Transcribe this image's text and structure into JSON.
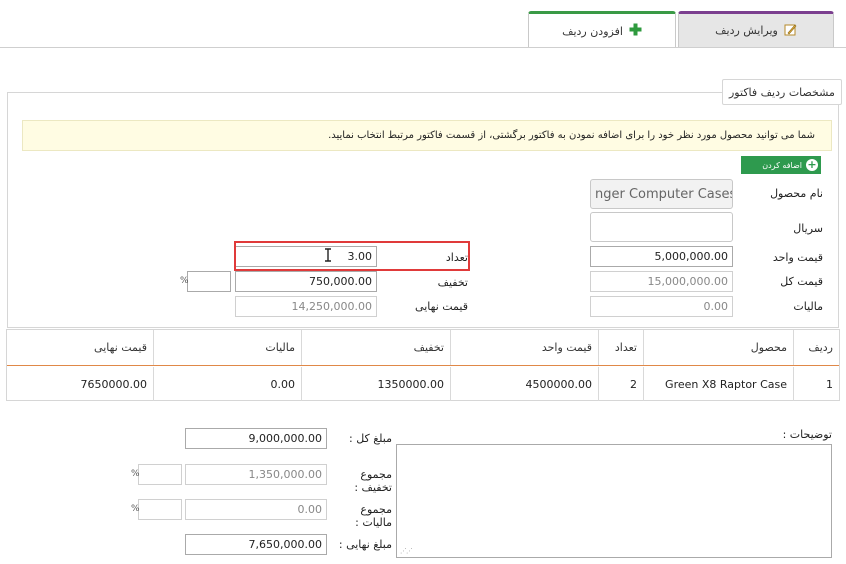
{
  "tabs": {
    "edit": {
      "label": "ویرایش ردیف",
      "icon": "edit-icon"
    },
    "add": {
      "label": "افزودن ردیف",
      "icon": "plus-icon"
    }
  },
  "form": {
    "legend": "مشخصات ردیف فاکتور",
    "notice": "شما می توانید محصول مورد نظر خود را برای اضافه نمودن به فاکتور برگشتی، از قسمت فاکتور مرتبط انتخاب نمایید.",
    "add_button": "اضافه کردن",
    "product_label": "نام محصول",
    "product_value": "nger Computer Cases",
    "serial_label": "سریال",
    "serial_value": "",
    "unit_price_label": "قیمت واحد",
    "unit_price_value": "5,000,000.00",
    "total_price_label": "قیمت کل",
    "total_price_value": "15,000,000.00",
    "tax_label": "مالیات",
    "tax_value": "0.00",
    "quantity_label": "تعداد",
    "quantity_value": "3.00",
    "discount_label": "تخفیف",
    "discount_value": "750,000.00",
    "discount_percent_value": "",
    "percent_sign": "%",
    "final_price_label": "قیمت نهایی",
    "final_price_value": "14,250,000.00"
  },
  "table": {
    "headers": [
      "ردیف",
      "محصول",
      "تعداد",
      "قیمت واحد",
      "تخفیف",
      "مالیات",
      "قیمت نهایی"
    ],
    "rows": [
      [
        "1",
        "Green X8 Raptor Case",
        "2",
        "4500000.00",
        "1350000.00",
        "0.00",
        "7650000.00"
      ]
    ]
  },
  "summary": {
    "notes_label": "توضیحات :",
    "total_label": "مبلغ کل :",
    "total_value": "9,000,000.00",
    "discount_sum_label": "مجموع تخفیف :",
    "discount_sum_value": "1,350,000.00",
    "tax_sum_label": "مجموع مالیات :",
    "tax_sum_value": "0.00",
    "final_label": "مبلغ نهایی :",
    "final_value": "7,650,000.00",
    "percent_sign": "%"
  },
  "colors": {
    "edit_tab_accent": "#7b3f8f",
    "add_tab_accent": "#3a9a46",
    "add_button": "#2e9a4e",
    "highlight_box": "#e03a3a",
    "notice_bg": "#fffce3"
  }
}
